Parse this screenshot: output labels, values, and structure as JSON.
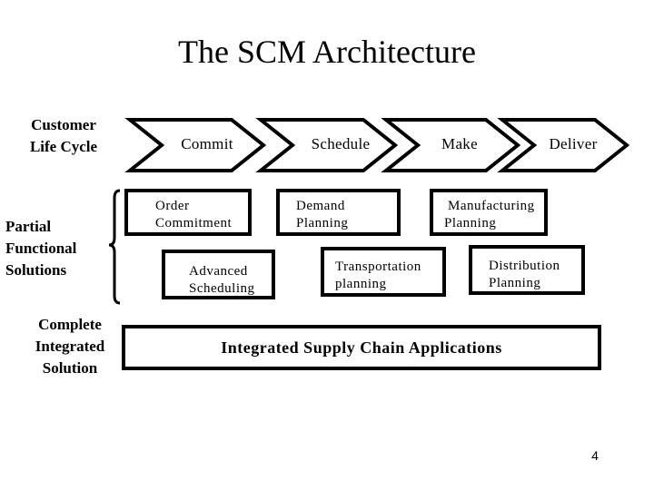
{
  "title": "The SCM Architecture",
  "row_labels": {
    "customer_life_cycle": [
      "Customer",
      "Life Cycle"
    ],
    "partial_functional": [
      "Partial",
      "Functional",
      "Solutions"
    ],
    "complete_integrated": [
      "Complete",
      "Integrated",
      "Solution"
    ]
  },
  "stages": [
    {
      "label": "Commit"
    },
    {
      "label": "Schedule"
    },
    {
      "label": "Make"
    },
    {
      "label": "Deliver"
    }
  ],
  "partial_solutions": {
    "order_commitment": [
      "Order",
      "Commitment"
    ],
    "demand_planning": [
      "Demand",
      "Planning"
    ],
    "manufacturing_planning": [
      "Manufacturing",
      "Planning"
    ],
    "advanced_scheduling": [
      "Advanced",
      "Scheduling"
    ],
    "transportation_planning": [
      "Transportation",
      "planning"
    ],
    "distribution_planning": [
      "Distribution",
      "Planning"
    ]
  },
  "integrated_solution": "Integrated Supply Chain Applications",
  "page_number": "4"
}
